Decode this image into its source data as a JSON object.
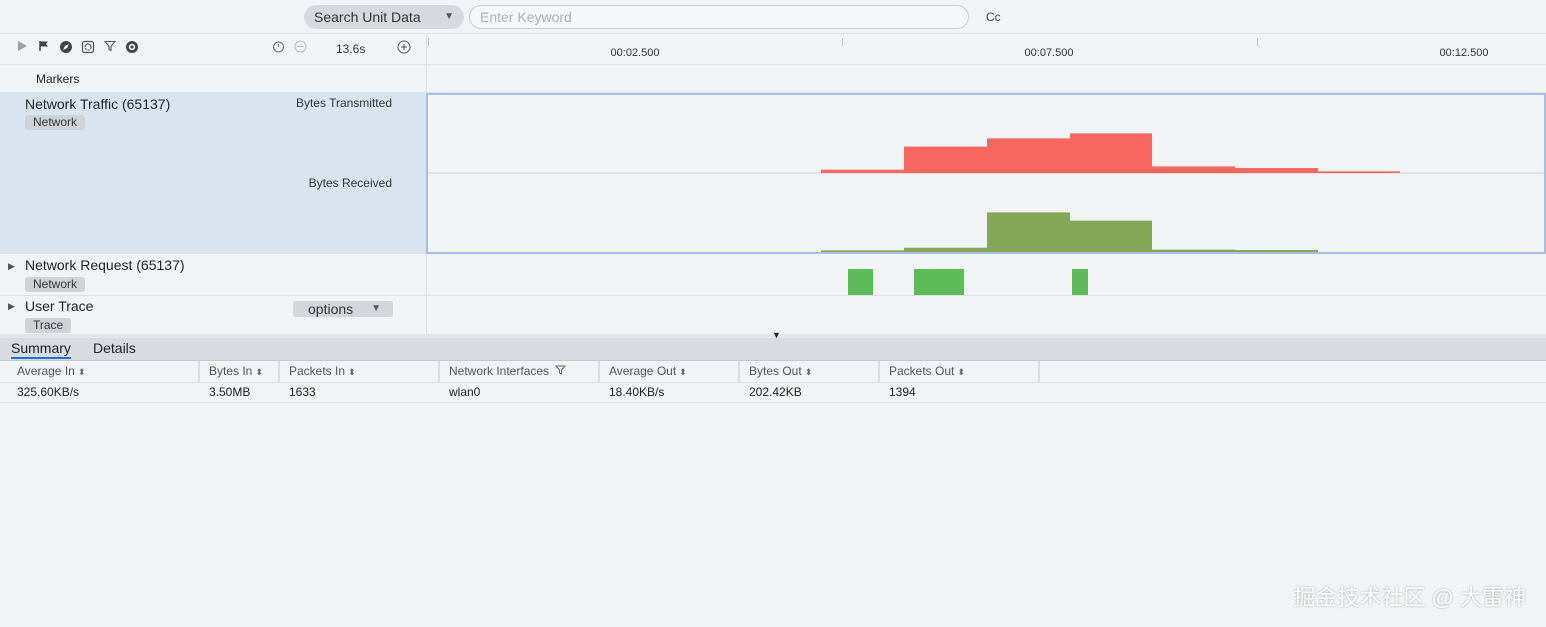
{
  "search": {
    "type_label": "Search Unit Data",
    "placeholder": "Enter Keyword",
    "case_toggle": "Cc"
  },
  "toolbar": {
    "zoom_level": "13.6s",
    "icons": [
      "play-icon",
      "flag-icon",
      "compass-icon",
      "refresh-icon",
      "filter-icon",
      "settings-icon",
      "timer-icon",
      "zoom-out-icon",
      "zoom-in-icon"
    ]
  },
  "ruler": {
    "ticks": [
      "00:02.500",
      "00:07.500",
      "00:12.500"
    ]
  },
  "markers": {
    "label": "Markers"
  },
  "lanes": {
    "network_traffic": {
      "title": "Network Traffic (65137)",
      "tag": "Network",
      "metric_tx": "Bytes Transmitted",
      "metric_rx": "Bytes Received",
      "tx_color": "#f7675f",
      "rx_color": "#82a857",
      "tx_levels": [
        0.1,
        0.8,
        1.05,
        1.2,
        0.2,
        0.15,
        0.05
      ],
      "rx_levels": [
        0.05,
        0.13,
        1.2,
        0.95,
        0.07,
        0.06
      ]
    },
    "network_request": {
      "title": "Network Request (65137)",
      "tag": "Network",
      "bar_color": "#5ebb5a"
    },
    "user_trace": {
      "title": "User Trace",
      "tag": "Trace",
      "options_label": "options"
    }
  },
  "details": {
    "tabs": [
      "Summary",
      "Details"
    ],
    "columns": [
      "Average In",
      "Bytes In",
      "Packets In",
      "Network Interfaces",
      "Average Out",
      "Bytes Out",
      "Packets Out"
    ],
    "row": [
      "325.60KB/s",
      "3.50MB",
      "1633",
      "wlan0",
      "18.40KB/s",
      "202.42KB",
      "1394"
    ]
  },
  "watermark": "掘金技术社区 @ 大雷神"
}
